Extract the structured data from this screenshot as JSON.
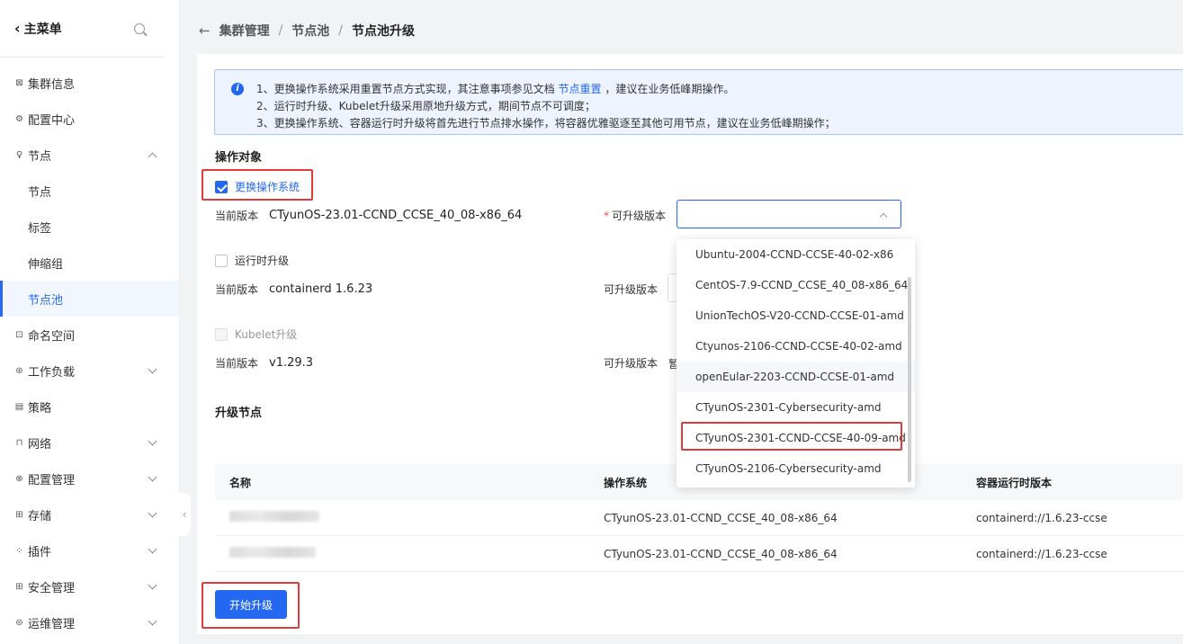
{
  "sidebar": {
    "title": "主菜单",
    "items": [
      {
        "label": "集群信息",
        "icon": "cluster-icon"
      },
      {
        "label": "配置中心",
        "icon": "config-icon"
      },
      {
        "label": "节点",
        "icon": "node-icon"
      },
      {
        "label": "节点",
        "sub": true
      },
      {
        "label": "标签",
        "sub": true
      },
      {
        "label": "伸缩组",
        "sub": true
      },
      {
        "label": "节点池",
        "sub": true,
        "active": true
      },
      {
        "label": "命名空间",
        "icon": "namespace-icon"
      },
      {
        "label": "工作负载",
        "icon": "workload-icon"
      },
      {
        "label": "策略",
        "icon": "policy-icon"
      },
      {
        "label": "网络",
        "icon": "network-icon"
      },
      {
        "label": "配置管理",
        "icon": "config-mgmt-icon"
      },
      {
        "label": "存储",
        "icon": "storage-icon"
      },
      {
        "label": "插件",
        "icon": "plugin-icon"
      },
      {
        "label": "安全管理",
        "icon": "security-icon"
      },
      {
        "label": "运维管理",
        "icon": "ops-icon"
      }
    ]
  },
  "breadcrumb": {
    "c1": "集群管理",
    "c2": "节点池",
    "c3": "节点池升级"
  },
  "notice": {
    "line1_a": "1、更换操作系统采用重置节点方式实现，其注意事项参见文档",
    "line1_link": "节点重置",
    "line1_b": "，建议在业务低峰期操作。",
    "line2": "2、运行时升级、Kubelet升级采用原地升级方式，期间节点不可调度；",
    "line3": "3、更换操作系统、容器运行时升级将首先进行节点排水操作，将容器优雅驱逐至其他可用节点，建议在业务低峰期操作；"
  },
  "operation": {
    "title": "操作对象",
    "os": {
      "label": "更换操作系统",
      "checked": true,
      "current_label": "当前版本",
      "current_value": "CTyunOS-23.01-CCND_CCSE_40_08-x86_64",
      "upgrade_label": "可升级版本",
      "required_mark": "*"
    },
    "runtime": {
      "label": "运行时升级",
      "checked": false,
      "current_label": "当前版本",
      "current_value": "containerd 1.6.23",
      "upgrade_label": "可升级版本"
    },
    "kubelet": {
      "label": "Kubelet升级",
      "checked": false,
      "disabled": true,
      "current_label": "当前版本",
      "current_value": "v1.29.3",
      "upgrade_label": "可升级版本",
      "upgrade_value_partial": "暂"
    }
  },
  "nodes": {
    "title": "升级节点",
    "headers": [
      "名称",
      "操作系统",
      "容器运行时版本"
    ],
    "rows": [
      {
        "os": "CTyunOS-23.01-CCND_CCSE_40_08-x86_64",
        "runtime": "containerd://1.6.23-ccse"
      },
      {
        "os": "CTyunOS-23.01-CCND_CCSE_40_08-x86_64",
        "runtime": "containerd://1.6.23-ccse"
      }
    ]
  },
  "start_button": "开始升级",
  "dropdown": {
    "options": [
      "Ubuntu-2004-CCND-CCSE-40-02-x86",
      "CentOS-7.9-CCND_CCSE_40_08-x86_64",
      "UnionTechOS-V20-CCND-CCSE-01-amd",
      "Ctyunos-2106-CCND-CCSE-40-02-amd",
      "openEular-2203-CCND-CCSE-01-amd",
      "CTyunOS-2301-Cybersecurity-amd",
      "CTyunOS-2301-CCND-CCSE-40-09-amd",
      "CTyunOS-2106-Cybersecurity-amd"
    ],
    "hover_index": 4,
    "highlighted_index": 6
  },
  "colors": {
    "accent": "#2468f2",
    "highlight": "#e03b3b"
  }
}
